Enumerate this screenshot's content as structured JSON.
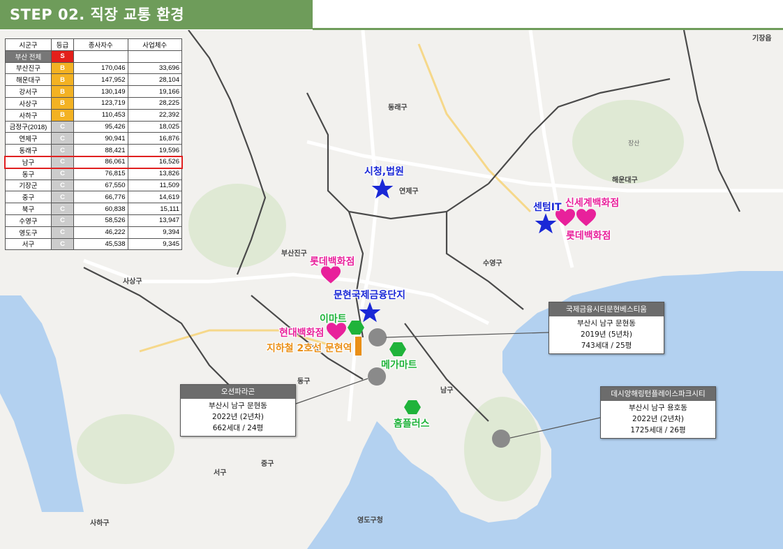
{
  "header": {
    "title": "STEP 02.  직장 교통 환경"
  },
  "table": {
    "headers": [
      "시군구",
      "등급",
      "종사자수",
      "사업체수"
    ],
    "rows": [
      {
        "name": "부산 전체",
        "grade": "S",
        "employees": "",
        "businesses": ""
      },
      {
        "name": "부산진구",
        "grade": "B",
        "employees": "170,046",
        "businesses": "33,696"
      },
      {
        "name": "해운대구",
        "grade": "B",
        "employees": "147,952",
        "businesses": "28,104"
      },
      {
        "name": "강서구",
        "grade": "B",
        "employees": "130,149",
        "businesses": "19,166"
      },
      {
        "name": "사상구",
        "grade": "B",
        "employees": "123,719",
        "businesses": "28,225"
      },
      {
        "name": "사하구",
        "grade": "B",
        "employees": "110,453",
        "businesses": "22,392"
      },
      {
        "name": "금정구(2018)",
        "grade": "C",
        "employees": "95,426",
        "businesses": "18,025"
      },
      {
        "name": "연제구",
        "grade": "C",
        "employees": "90,941",
        "businesses": "16,876"
      },
      {
        "name": "동래구",
        "grade": "C",
        "employees": "88,421",
        "businesses": "19,596"
      },
      {
        "name": "남구",
        "grade": "C",
        "employees": "86,061",
        "businesses": "16,526"
      },
      {
        "name": "동구",
        "grade": "C",
        "employees": "76,815",
        "businesses": "13,826"
      },
      {
        "name": "기장군",
        "grade": "C",
        "employees": "67,550",
        "businesses": "11,509"
      },
      {
        "name": "중구",
        "grade": "C",
        "employees": "66,776",
        "businesses": "14,619"
      },
      {
        "name": "북구",
        "grade": "C",
        "employees": "60,838",
        "businesses": "15,111"
      },
      {
        "name": "수영구",
        "grade": "C",
        "employees": "58,526",
        "businesses": "13,947"
      },
      {
        "name": "영도구",
        "grade": "C",
        "employees": "46,222",
        "businesses": "9,394"
      },
      {
        "name": "서구",
        "grade": "C",
        "employees": "45,538",
        "businesses": "9,345"
      }
    ]
  },
  "map_labels": {
    "gijang": "기장읍",
    "dongnae": "동래구",
    "yeonje": "연제구",
    "haeundae": "해운대구",
    "busanjin": "부산진구",
    "suyeong": "수영구",
    "sasang": "사상구",
    "nam": "남구",
    "dong": "동구",
    "jung": "중구",
    "seo": "서구",
    "saha": "사하구",
    "yeongdo": "영도구청",
    "jangsan": "장산"
  },
  "pins": {
    "city_hall": "시청,법원",
    "centum": "센텀IT",
    "shinsegae": "신세계백화점",
    "lotte_centum": "롯데백화점",
    "lotte_seomyeon": "롯데백화점",
    "munhyeon_finance": "문현국제금융단지",
    "emart": "이마트",
    "hyundai": "현대백화점",
    "subway": "지하철 2호선 문현역",
    "mega_mart": "메가마트",
    "homeplus": "홈플러스"
  },
  "infoboxes": [
    {
      "title": "국제금융시티문현베스티움",
      "address": "부산시 남구 문현동",
      "year": "2019년 (5년차)",
      "units": "743세대 / 25평"
    },
    {
      "title": "오션파라곤",
      "address": "부산시 남구 문현동",
      "year": "2022년 (2년차)",
      "units": "662세대 / 24평"
    },
    {
      "title": "데시앙해링턴플레이스파크시티",
      "address": "부산시 남구 용호동",
      "year": "2022년 (2년차)",
      "units": "1725세대 / 26평"
    }
  ],
  "colors": {
    "header": "#6e9c5a",
    "grade_S": "#e3201b",
    "grade_B": "#f3b223",
    "grade_C": "#cccccc",
    "highlight": "#e02020",
    "workplace_star": "#1a28d6",
    "department_store_heart": "#e8219b",
    "mart_hexagon": "#1fb33a",
    "subway": "#ea8f16",
    "apartment_circle": "#8a8a8a",
    "sea": "#b3d1f0"
  }
}
